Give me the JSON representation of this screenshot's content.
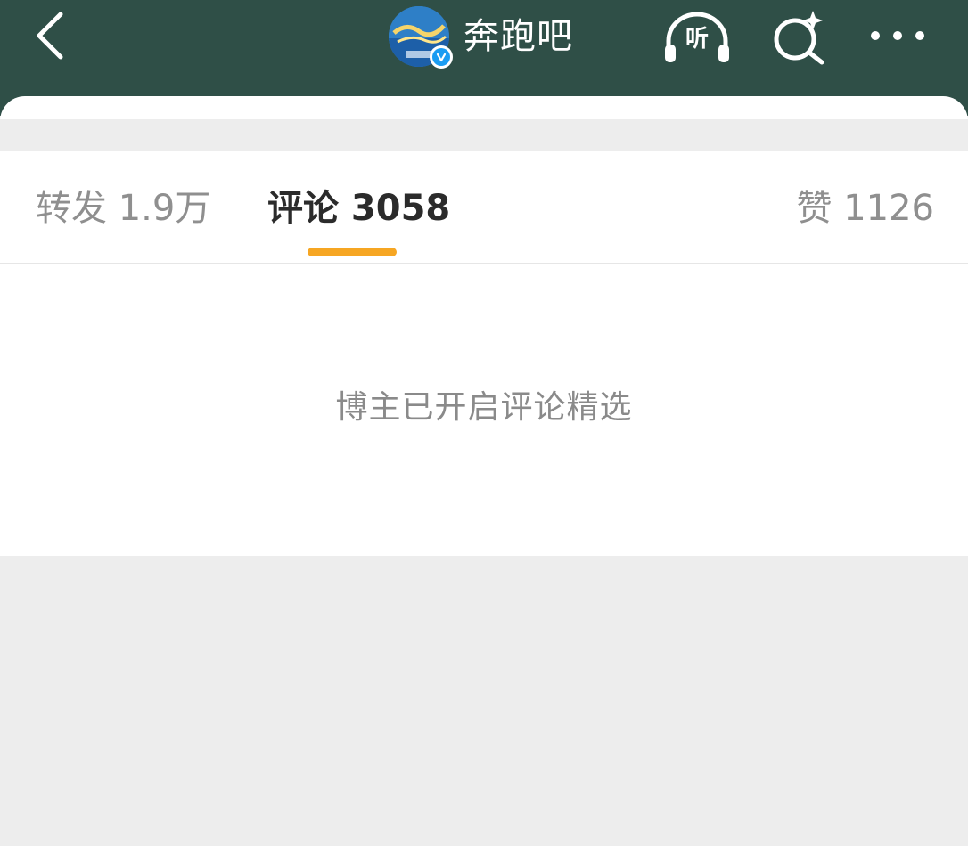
{
  "header": {
    "title": "奔跑吧",
    "listen_label": "听",
    "icons": {
      "back": "back-chevron-icon",
      "listen": "headphones-icon",
      "search": "sparkle-search-icon",
      "more": "more-dots-icon",
      "verified": "verified-badge-icon"
    },
    "background_color": "#2f4f47"
  },
  "tabs": {
    "repost": "转发 1.9万",
    "comment": "评论 3058",
    "like": "赞 1126",
    "active": "comment",
    "active_indicator_color": "#f6a623"
  },
  "content": {
    "notice": "博主已开启评论精选"
  }
}
